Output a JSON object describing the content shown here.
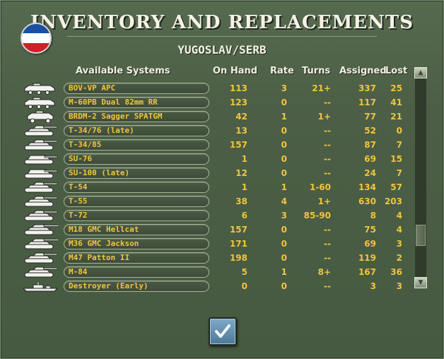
{
  "dialog": {
    "title": "INVENTORY AND REPLACEMENTS",
    "subtitle": "YUGOSLAV/SERB",
    "flag_colors": [
      "#1a4fa3",
      "#ffffff",
      "#d0202a"
    ]
  },
  "table": {
    "headers": {
      "system": "Available Systems",
      "on_hand": "On Hand",
      "rate": "Rate",
      "turns": "Turns",
      "assigned": "Assigned",
      "lost": "Lost"
    },
    "rows": [
      {
        "name": "BOV-VP APC",
        "icon": "apc-icon",
        "on_hand": "113",
        "rate": "3",
        "turns": "21+",
        "assigned": "337",
        "lost": "25"
      },
      {
        "name": "M-60PB Dual 82mm RR",
        "icon": "apc-icon",
        "on_hand": "123",
        "rate": "0",
        "turns": "--",
        "assigned": "117",
        "lost": "41"
      },
      {
        "name": "BRDM-2 Sagger SPATGM",
        "icon": "armored-car-icon",
        "on_hand": "42",
        "rate": "1",
        "turns": "1+",
        "assigned": "77",
        "lost": "21"
      },
      {
        "name": "T-34/76 (late)",
        "icon": "tank-icon",
        "on_hand": "13",
        "rate": "0",
        "turns": "--",
        "assigned": "52",
        "lost": "0"
      },
      {
        "name": "T-34/85",
        "icon": "tank-icon",
        "on_hand": "157",
        "rate": "0",
        "turns": "--",
        "assigned": "87",
        "lost": "7"
      },
      {
        "name": "SU-76",
        "icon": "assault-gun-icon",
        "on_hand": "1",
        "rate": "0",
        "turns": "--",
        "assigned": "69",
        "lost": "15"
      },
      {
        "name": "SU-100 (late)",
        "icon": "assault-gun-icon",
        "on_hand": "12",
        "rate": "0",
        "turns": "--",
        "assigned": "24",
        "lost": "7"
      },
      {
        "name": "T-54",
        "icon": "tank-icon",
        "on_hand": "1",
        "rate": "1",
        "turns": "1-60",
        "assigned": "134",
        "lost": "57"
      },
      {
        "name": "T-55",
        "icon": "tank-icon",
        "on_hand": "38",
        "rate": "4",
        "turns": "1+",
        "assigned": "630",
        "lost": "203"
      },
      {
        "name": "T-72",
        "icon": "tank-icon",
        "on_hand": "6",
        "rate": "3",
        "turns": "85-90",
        "assigned": "8",
        "lost": "4"
      },
      {
        "name": "M18 GMC Hellcat",
        "icon": "tank-destroyer-icon",
        "on_hand": "157",
        "rate": "0",
        "turns": "--",
        "assigned": "75",
        "lost": "4"
      },
      {
        "name": "M36 GMC Jackson",
        "icon": "tank-destroyer-icon",
        "on_hand": "171",
        "rate": "0",
        "turns": "--",
        "assigned": "69",
        "lost": "3"
      },
      {
        "name": "M47 Patton II",
        "icon": "tank-icon",
        "on_hand": "198",
        "rate": "0",
        "turns": "--",
        "assigned": "119",
        "lost": "2"
      },
      {
        "name": "M-84",
        "icon": "tank-icon",
        "on_hand": "5",
        "rate": "1",
        "turns": "8+",
        "assigned": "167",
        "lost": "36"
      },
      {
        "name": "Destroyer (Early)",
        "icon": "destroyer-icon",
        "on_hand": "0",
        "rate": "0",
        "turns": "--",
        "assigned": "3",
        "lost": "3"
      }
    ]
  },
  "scrollbar": {
    "up_icon": "scroll-up-icon",
    "down_icon": "scroll-down-icon"
  },
  "ok_button": {
    "icon": "checkmark-icon"
  }
}
